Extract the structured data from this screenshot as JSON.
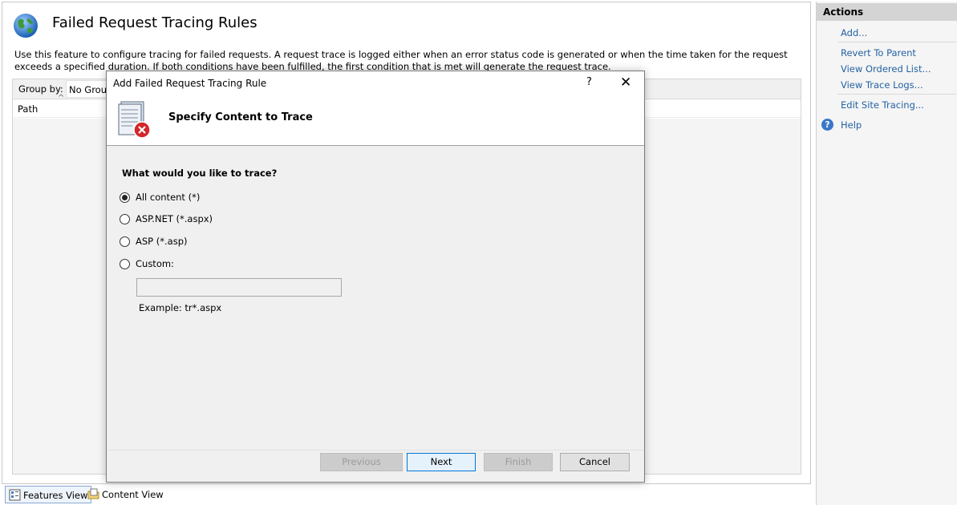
{
  "page": {
    "title": "Failed Request Tracing Rules",
    "description": "Use this feature to configure tracing for failed requests. A request trace is logged either when an error status code is generated or when the time taken for the request exceeds a specified duration. If both conditions have been fulfilled, the first condition that is met will generate the request trace.",
    "group_by_label": "Group by:",
    "group_by_value": "No Group",
    "column_path": "Path"
  },
  "view_tabs": {
    "features": "Features View",
    "content": "Content View"
  },
  "actions": {
    "header": "Actions",
    "add": "Add...",
    "revert": "Revert To Parent",
    "ordered_list": "View Ordered List...",
    "trace_logs": "View Trace Logs...",
    "edit_site": "Edit Site Tracing...",
    "help": "Help"
  },
  "dialog": {
    "title": "Add Failed Request Tracing Rule",
    "help_glyph": "?",
    "close_glyph": "✕",
    "banner_title": "Specify Content to Trace",
    "question": "What would you like to trace?",
    "options": [
      {
        "label": "All content (*)",
        "checked": true
      },
      {
        "label": "ASP.NET (*.aspx)",
        "checked": false
      },
      {
        "label": "ASP (*.asp)",
        "checked": false
      },
      {
        "label": "Custom:",
        "checked": false
      }
    ],
    "custom_value": "",
    "example": "Example: tr*.aspx",
    "buttons": {
      "previous": "Previous",
      "next": "Next",
      "finish": "Finish",
      "cancel": "Cancel"
    }
  },
  "colors": {
    "link": "#2462a4",
    "actions_header": "#d4d4d4",
    "default_button_border": "#0078d7"
  }
}
